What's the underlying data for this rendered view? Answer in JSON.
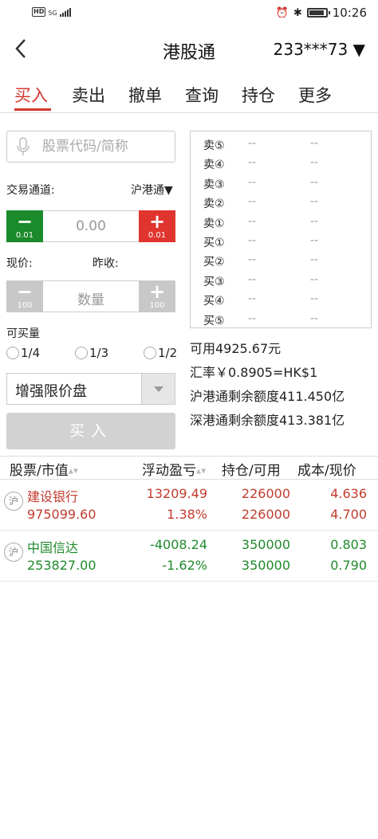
{
  "status_bar": {
    "left": "HD 5G",
    "time": "10:26"
  },
  "header": {
    "back_icon": "chevron-left-icon",
    "title": "港股通",
    "account": "233***73 ▼"
  },
  "tabs": [
    {
      "label": "买入"
    },
    {
      "label": "卖出"
    },
    {
      "label": "撤单"
    },
    {
      "label": "查询"
    },
    {
      "label": "持仓"
    },
    {
      "label": "更多"
    }
  ],
  "form": {
    "search_placeholder": "股票代码/简称",
    "channel_label": "交易通道:",
    "channel_value": "沪港通▼",
    "price_value": "0.00",
    "price_step": "0.01",
    "current_price_label": "现价:",
    "prev_close_label": "昨收:",
    "qty_placeholder": "数量",
    "qty_step": "100",
    "buyable_label": "可买量",
    "fractions": [
      "1/4",
      "1/3",
      "1/2"
    ],
    "order_type": "增强限价盘",
    "buy_label": "买入"
  },
  "orderbook": [
    {
      "label": "卖⑤",
      "price": "--",
      "vol": "--"
    },
    {
      "label": "卖④",
      "price": "--",
      "vol": "--"
    },
    {
      "label": "卖③",
      "price": "--",
      "vol": "--"
    },
    {
      "label": "卖②",
      "price": "--",
      "vol": "--"
    },
    {
      "label": "卖①",
      "price": "--",
      "vol": "--"
    },
    {
      "label": "买①",
      "price": "--",
      "vol": "--"
    },
    {
      "label": "买②",
      "price": "--",
      "vol": "--"
    },
    {
      "label": "买③",
      "price": "--",
      "vol": "--"
    },
    {
      "label": "买④",
      "price": "--",
      "vol": "--"
    },
    {
      "label": "买⑤",
      "price": "--",
      "vol": "--"
    }
  ],
  "info": {
    "available": "可用4925.67元",
    "rate": "汇率￥0.8905=HK$1",
    "sh_quota": "沪港通剩余额度411.450亿",
    "sz_quota": "深港通剩余额度413.381亿"
  },
  "positions_header": {
    "stock": "股票/市值",
    "pnl": "浮动盈亏",
    "hold": "持仓/可用",
    "cost": "成本/现价"
  },
  "positions": [
    {
      "badge": "沪",
      "name": "建设银行",
      "market_value": "975099.60",
      "pnl": "13209.49",
      "pnl_pct": "1.38%",
      "hold": "226000",
      "avail": "226000",
      "cost": "4.636",
      "price": "4.700",
      "color": "#c23b2e"
    },
    {
      "badge": "沪",
      "name": "中国信达",
      "market_value": "253827.00",
      "pnl": "-4008.24",
      "pnl_pct": "-1.62%",
      "hold": "350000",
      "avail": "350000",
      "cost": "0.803",
      "price": "0.790",
      "color": "#1f8a2c"
    }
  ],
  "colors": {
    "accent": "#d6362f",
    "minus_green": "#1a8a2a",
    "plus_red": "#e0342e",
    "disabled": "#d2d2d2"
  }
}
